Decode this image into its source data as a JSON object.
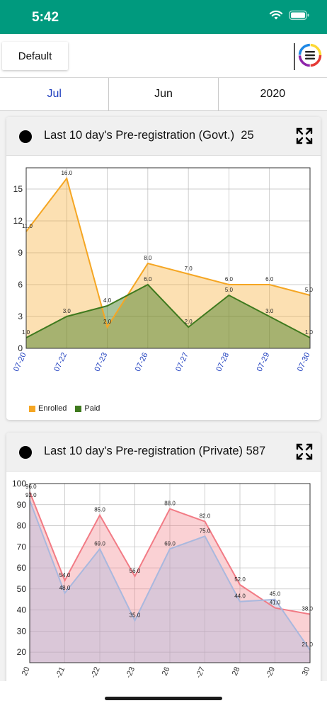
{
  "status": {
    "time": "5:42"
  },
  "toolbar": {
    "default_label": "Default"
  },
  "tabs": [
    {
      "label": "Jul",
      "active": true
    },
    {
      "label": "Jun",
      "active": false
    },
    {
      "label": "2020",
      "active": false
    }
  ],
  "cards": [
    {
      "title": "Last 10 day's Pre-registration (Govt.)",
      "count": "25"
    },
    {
      "title": "Last 10 day's Pre-registration (Private)",
      "count": "587"
    }
  ],
  "colors": {
    "status_bar": "#009a7e",
    "enrolled": "#f5a623",
    "paid": "#3f7a1e",
    "private_enrolled": "#f27b85",
    "private_paid": "#a9b8de",
    "active_tab": "#1f3fbf"
  },
  "chart_data": [
    {
      "type": "area",
      "categories": [
        "07-20",
        "07-22",
        "07-23",
        "07-26",
        "07-27",
        "07-28",
        "07-29",
        "07-30"
      ],
      "series": [
        {
          "name": "Enrolled",
          "values": [
            11,
            16,
            2,
            8,
            7,
            6,
            6,
            5
          ],
          "labels": [
            "11.0",
            "16.0",
            "2.0",
            "8.0",
            "7.0",
            "6.0",
            "6.0",
            "5.0"
          ]
        },
        {
          "name": "Paid",
          "values": [
            1,
            3,
            4,
            6,
            2,
            5,
            3,
            1
          ],
          "labels": [
            "1.0",
            "3.0",
            "4.0",
            "6.0",
            "2.0",
            "5.0",
            "3.0",
            "1.0"
          ]
        }
      ],
      "yticks": [
        "0",
        "3",
        "6",
        "9",
        "12",
        "15"
      ],
      "ylim": [
        0,
        17
      ],
      "legend": [
        "Enrolled",
        "Paid"
      ]
    },
    {
      "type": "area",
      "categories": [
        "20",
        "-21",
        "-22",
        "-23",
        "26",
        "-27",
        "28",
        "-29",
        "30"
      ],
      "series": [
        {
          "values": [
            96,
            54,
            85,
            56,
            88,
            82,
            52,
            41,
            38
          ],
          "labels": [
            "96.0",
            "54.0",
            "85.0",
            "56.0",
            "88.0",
            "82.0",
            "52.0",
            "41.0",
            "38.0"
          ]
        },
        {
          "values": [
            92,
            48,
            69,
            35,
            69,
            75,
            44,
            45,
            21
          ],
          "labels": [
            "92.0",
            "48.0",
            "69.0",
            "35.0",
            "69.0",
            "75.0",
            "44.0",
            "45.0",
            "21.0"
          ]
        }
      ],
      "yticks": [
        "20",
        "30",
        "40",
        "50",
        "60",
        "70",
        "80",
        "90",
        "100"
      ],
      "ylim": [
        15,
        100
      ]
    }
  ]
}
